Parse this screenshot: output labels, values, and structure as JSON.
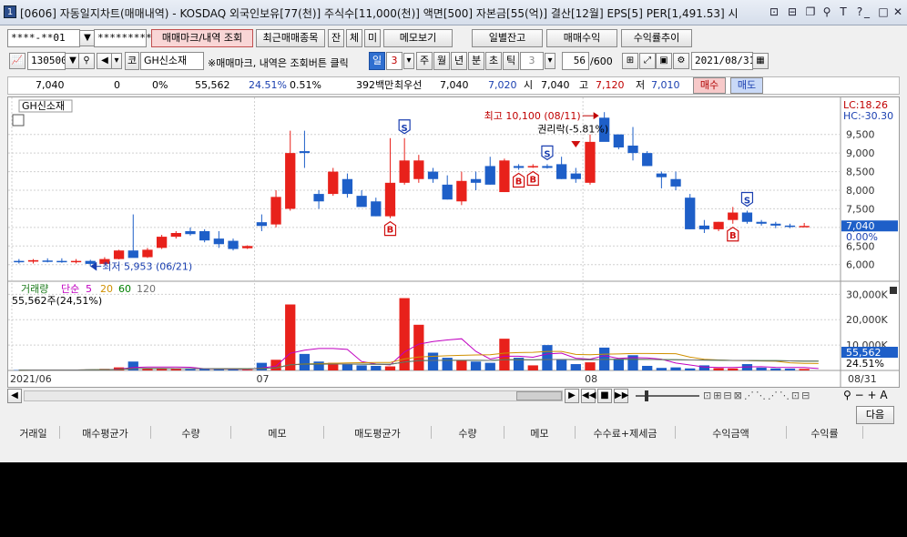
{
  "window": {
    "icon_label": "1",
    "title": "[0606] 자동일지차트(매매내역) - KOSDAQ 외국인보유[77(천)] 주식수[11,000(천)] 액면[500] 자본금[55(억)] 결산[12월] EPS[5] PER[1,491.53] 시",
    "title_icons": [
      "window-list-icon",
      "window-split-icon",
      "window-restore-icon",
      "pin-icon",
      "font-size-icon",
      "help-icon",
      "minimize-icon",
      "maximize-icon",
      "close-icon"
    ],
    "title_glyphs": [
      "⊡",
      "⊟",
      "❐",
      "⚲",
      "T",
      "?",
      "_",
      "□",
      "✕"
    ]
  },
  "toolbar1": {
    "account": "****-**01",
    "password": "*********",
    "buttons": [
      "매매마크/내역 조회",
      "최근매매종목",
      "잔",
      "체",
      "미",
      "메모보기",
      "일별잔고",
      "매매수익",
      "수익률추이"
    ]
  },
  "toolbar2": {
    "code": "130500",
    "market": "코",
    "name": "GH신소재",
    "hint": "※매매마크, 내역은 조회버튼 클릭",
    "periods": [
      "일",
      "주",
      "월",
      "년",
      "분",
      "초",
      "틱"
    ],
    "active_period": "일",
    "period_num": "3",
    "tick_num": "3",
    "count": "56",
    "count_max": "/600",
    "date": "2021/08/31"
  },
  "pricebar": {
    "price": "7,040",
    "change": "0",
    "rate": "0%",
    "volume": "55,562",
    "vol_rate": "24.51%",
    "turnover": "0.51%",
    "amount": "392백만",
    "best_label": "최우선",
    "best_ask": "7,040",
    "best_bid": "7,020",
    "open_label": "시",
    "open": "7,040",
    "high_label": "고",
    "high": "7,120",
    "low_label": "저",
    "low": "7,010",
    "buy": "매수",
    "sell": "매도"
  },
  "chart_data": {
    "type": "candlestick",
    "title": "GH신소재",
    "lc_label": "LC:18.26",
    "hc_label": "HC:-30.30",
    "y_ticks": [
      "9,500",
      "9,000",
      "8,500",
      "8,000",
      "7,500",
      "7,000",
      "6,500",
      "6,000"
    ],
    "y_tick_values": [
      9500,
      9000,
      8500,
      8000,
      7500,
      7000,
      6500,
      6000
    ],
    "current_price_label": "7,040",
    "current_pct_label": "0.00%",
    "high_annotation": "최고 10,100 (08/11)",
    "low_annotation": "최저 5,953 (06/21)",
    "rights_annotation": "권리락(-5.81%)",
    "x_labels": [
      "2021/06",
      "07",
      "08",
      "08/31"
    ],
    "ylim": [
      5700,
      10300
    ],
    "candles": [
      {
        "o": 6100,
        "h": 6150,
        "l": 6030,
        "c": 6080
      },
      {
        "o": 6080,
        "h": 6150,
        "l": 6030,
        "c": 6120
      },
      {
        "o": 6110,
        "h": 6170,
        "l": 6060,
        "c": 6100
      },
      {
        "o": 6100,
        "h": 6170,
        "l": 6050,
        "c": 6090
      },
      {
        "o": 6080,
        "h": 6150,
        "l": 6030,
        "c": 6100
      },
      {
        "o": 6100,
        "h": 6130,
        "l": 5953,
        "c": 6020
      },
      {
        "o": 6020,
        "h": 6200,
        "l": 6000,
        "c": 6150
      },
      {
        "o": 6150,
        "h": 6400,
        "l": 6140,
        "c": 6380
      },
      {
        "o": 6380,
        "h": 7350,
        "l": 6320,
        "c": 6180
      },
      {
        "o": 6200,
        "h": 6450,
        "l": 6180,
        "c": 6400
      },
      {
        "o": 6450,
        "h": 6800,
        "l": 6420,
        "c": 6750
      },
      {
        "o": 6750,
        "h": 6900,
        "l": 6700,
        "c": 6850
      },
      {
        "o": 6900,
        "h": 7000,
        "l": 6780,
        "c": 6820
      },
      {
        "o": 6900,
        "h": 6950,
        "l": 6600,
        "c": 6650
      },
      {
        "o": 6700,
        "h": 6900,
        "l": 6450,
        "c": 6550
      },
      {
        "o": 6640,
        "h": 6700,
        "l": 6380,
        "c": 6420
      },
      {
        "o": 6440,
        "h": 6520,
        "l": 6420,
        "c": 6500
      },
      {
        "o": 7140,
        "h": 7350,
        "l": 6900,
        "c": 7040
      },
      {
        "o": 7080,
        "h": 8000,
        "l": 7000,
        "c": 7820
      },
      {
        "o": 7500,
        "h": 9600,
        "l": 7450,
        "c": 9000
      },
      {
        "o": 9050,
        "h": 9600,
        "l": 8600,
        "c": 9000
      },
      {
        "o": 7900,
        "h": 8000,
        "l": 7500,
        "c": 7700
      },
      {
        "o": 7900,
        "h": 8600,
        "l": 7850,
        "c": 8500
      },
      {
        "o": 8300,
        "h": 8450,
        "l": 7800,
        "c": 7900
      },
      {
        "o": 7850,
        "h": 8000,
        "l": 7600,
        "c": 7550
      },
      {
        "o": 7700,
        "h": 7800,
        "l": 7300,
        "c": 7300
      },
      {
        "o": 7300,
        "h": 9400,
        "l": 7250,
        "c": 8200
      },
      {
        "o": 8200,
        "h": 9400,
        "l": 8150,
        "c": 8800
      },
      {
        "o": 8300,
        "h": 8950,
        "l": 8200,
        "c": 8800
      },
      {
        "o": 8500,
        "h": 8600,
        "l": 8200,
        "c": 8300
      },
      {
        "o": 8150,
        "h": 8400,
        "l": 7750,
        "c": 7750
      },
      {
        "o": 7700,
        "h": 8500,
        "l": 7600,
        "c": 8250
      },
      {
        "o": 8300,
        "h": 8500,
        "l": 8000,
        "c": 8200
      },
      {
        "o": 8650,
        "h": 8900,
        "l": 8150,
        "c": 8150
      },
      {
        "o": 7950,
        "h": 8850,
        "l": 7950,
        "c": 8800
      },
      {
        "o": 8650,
        "h": 8700,
        "l": 8550,
        "c": 8600
      },
      {
        "o": 8650,
        "h": 8700,
        "l": 8600,
        "c": 8650
      },
      {
        "o": 8650,
        "h": 8700,
        "l": 8580,
        "c": 8600
      },
      {
        "o": 8700,
        "h": 8900,
        "l": 8300,
        "c": 8300
      },
      {
        "o": 8450,
        "h": 8600,
        "l": 8200,
        "c": 8300
      },
      {
        "o": 8200,
        "h": 9500,
        "l": 8150,
        "c": 9300
      },
      {
        "o": 9950,
        "h": 10100,
        "l": 9400,
        "c": 9300
      },
      {
        "o": 9500,
        "h": 9500,
        "l": 9100,
        "c": 9150
      },
      {
        "o": 9200,
        "h": 9700,
        "l": 8800,
        "c": 9000
      },
      {
        "o": 9000,
        "h": 9050,
        "l": 8650,
        "c": 8650
      },
      {
        "o": 8450,
        "h": 8500,
        "l": 8050,
        "c": 8350
      },
      {
        "o": 8300,
        "h": 8500,
        "l": 8000,
        "c": 8100
      },
      {
        "o": 7800,
        "h": 7900,
        "l": 6950,
        "c": 6950
      },
      {
        "o": 7050,
        "h": 7200,
        "l": 6850,
        "c": 6950
      },
      {
        "o": 6950,
        "h": 7150,
        "l": 6900,
        "c": 7150
      },
      {
        "o": 7200,
        "h": 7550,
        "l": 7100,
        "c": 7400
      },
      {
        "o": 7400,
        "h": 7450,
        "l": 7100,
        "c": 7150
      },
      {
        "o": 7150,
        "h": 7200,
        "l": 7050,
        "c": 7100
      },
      {
        "o": 7100,
        "h": 7150,
        "l": 6980,
        "c": 7050
      },
      {
        "o": 7050,
        "h": 7100,
        "l": 6980,
        "c": 7040
      },
      {
        "o": 7040,
        "h": 7120,
        "l": 7010,
        "c": 7040
      }
    ],
    "markers": [
      {
        "i": 26,
        "label": "B",
        "kind": "buy"
      },
      {
        "i": 27,
        "label": "S",
        "kind": "sell"
      },
      {
        "i": 35,
        "label": "B",
        "kind": "buy"
      },
      {
        "i": 36,
        "label": "B",
        "kind": "buy"
      },
      {
        "i": 37,
        "label": "S",
        "kind": "sell"
      },
      {
        "i": 50,
        "label": "B",
        "kind": "buy"
      },
      {
        "i": 51,
        "label": "S",
        "kind": "sell"
      }
    ],
    "volume": {
      "title": "거래량",
      "ma_label": "단순",
      "ma_periods": [
        "5",
        "20",
        "60",
        "120"
      ],
      "ma_colors": [
        "#c000c0",
        "#d09000",
        "#008000",
        "#707070"
      ],
      "info": "55,562주(24,51%)",
      "y_ticks": [
        "30,000K",
        "20,000K",
        "10,000K"
      ],
      "y_tick_values": [
        30000,
        20000,
        10000
      ],
      "current_label": "55,562",
      "pct_label": "24.51%",
      "ylim": [
        0,
        33000
      ],
      "values": [
        150,
        200,
        180,
        160,
        170,
        400,
        600,
        1200,
        3500,
        900,
        700,
        600,
        500,
        700,
        500,
        400,
        300,
        3000,
        4200,
        26000,
        6500,
        3500,
        3000,
        2500,
        2000,
        1800,
        1600,
        28500,
        18000,
        7000,
        5000,
        4000,
        3500,
        3000,
        12500,
        5000,
        2000,
        10000,
        4500,
        2500,
        3200,
        9000,
        4500,
        6000,
        1800,
        1000,
        1200,
        800,
        2000,
        900,
        800,
        2500,
        1100,
        800,
        700,
        600,
        600
      ]
    },
    "grid": true,
    "legend": "top-left"
  },
  "bottom": {
    "next_button": "다음",
    "columns": [
      "거래일",
      "매수평균가",
      "수량",
      "메모",
      "매도평균가",
      "수량",
      "메모",
      "수수료+제세금",
      "수익금액",
      "수익률"
    ]
  }
}
